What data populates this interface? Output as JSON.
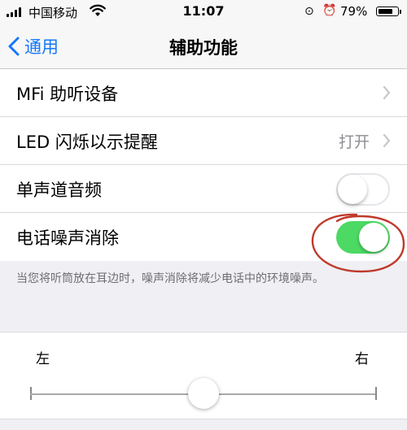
{
  "status_bar": {
    "carrier": "中国移动",
    "time": "11:07",
    "battery_percent": "79%",
    "battery_level": 0.79,
    "signal_bars": 4,
    "icons": [
      "signal-icon",
      "wifi-icon",
      "rotation-lock-icon",
      "alarm-icon",
      "battery-icon"
    ]
  },
  "nav": {
    "back_label": "通用",
    "title": "辅助功能"
  },
  "settings": {
    "rows": [
      {
        "label": "MFi 助听设备",
        "type": "disclosure",
        "value": ""
      },
      {
        "label": "LED 闪烁以示提醒",
        "type": "disclosure",
        "value": "打开"
      },
      {
        "label": "单声道音频",
        "type": "toggle",
        "on": false
      },
      {
        "label": "电话噪声消除",
        "type": "toggle",
        "on": true
      }
    ],
    "footer": "当您将听筒放在耳边时，噪声消除将减少电话中的环境噪声。"
  },
  "balance": {
    "left_label": "左",
    "right_label": "右",
    "value": 0.5
  },
  "colors": {
    "accent": "#1478fa",
    "toggle_on": "#4cd964",
    "annotation": "#c0392b"
  }
}
